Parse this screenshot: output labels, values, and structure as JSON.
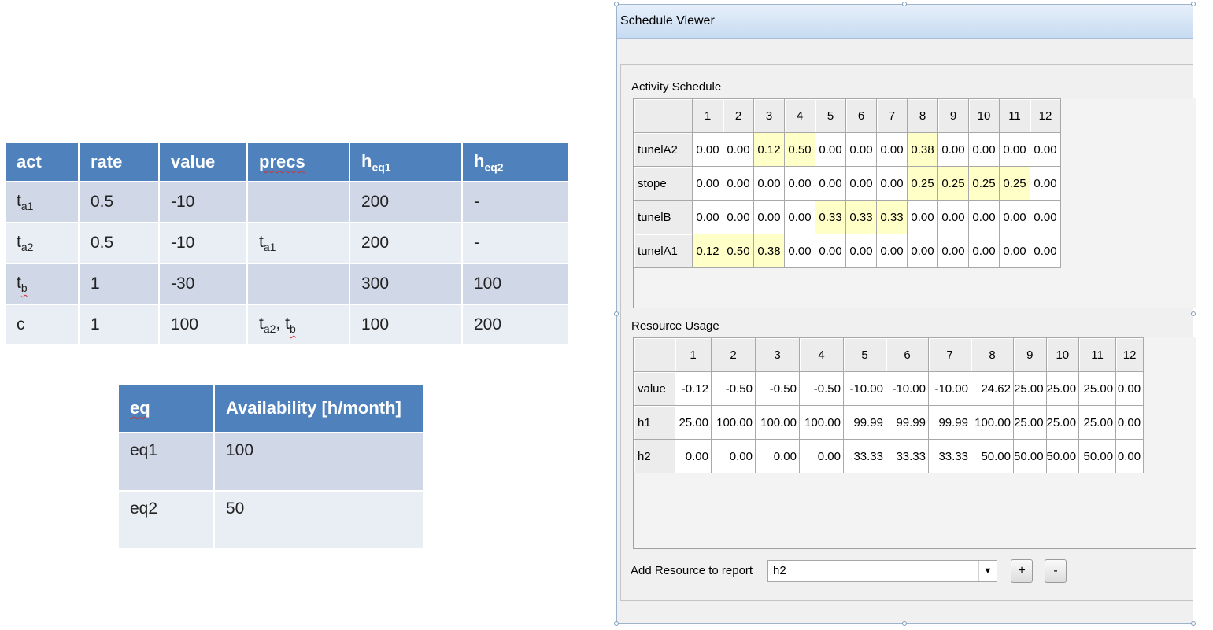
{
  "params_table": {
    "headers": [
      {
        "base": "act",
        "sub": ""
      },
      {
        "base": "rate",
        "sub": ""
      },
      {
        "base": "value",
        "sub": ""
      },
      {
        "base": "precs",
        "sub": ""
      },
      {
        "base": "h",
        "sub": "eq1"
      },
      {
        "base": "h",
        "sub": "eq2"
      }
    ],
    "rows": [
      {
        "act": {
          "base": "t",
          "sub": "a1"
        },
        "rate": "0.5",
        "value": "-10",
        "precs": [],
        "heq1": "200",
        "heq2": "-"
      },
      {
        "act": {
          "base": "t",
          "sub": "a2"
        },
        "rate": "0.5",
        "value": "-10",
        "precs": [
          {
            "base": "t",
            "sub": "a1"
          }
        ],
        "heq1": "200",
        "heq2": "-"
      },
      {
        "act": {
          "base": "t",
          "sub": "b"
        },
        "rate": "1",
        "value": "-30",
        "precs": [],
        "heq1": "300",
        "heq2": "100"
      },
      {
        "act": {
          "base": "c",
          "sub": ""
        },
        "rate": "1",
        "value": "100",
        "precs": [
          {
            "base": "t",
            "sub": "a2"
          },
          {
            "base": "t",
            "sub": "b"
          }
        ],
        "heq1": "100",
        "heq2": "200"
      }
    ]
  },
  "availability_table": {
    "headers": [
      "eq",
      "Availability [h/month]"
    ],
    "rows": [
      [
        "eq1",
        "100"
      ],
      [
        "eq2",
        "50"
      ]
    ]
  },
  "window": {
    "title": "Schedule Viewer",
    "activity_label": "Activity Schedule",
    "activity_columns": [
      "1",
      "2",
      "3",
      "4",
      "5",
      "6",
      "7",
      "8",
      "9",
      "10",
      "11",
      "12"
    ],
    "activity_rows": [
      {
        "name": "tunelA2",
        "values": [
          "0.00",
          "0.00",
          "0.12",
          "0.50",
          "0.00",
          "0.00",
          "0.00",
          "0.38",
          "0.00",
          "0.00",
          "0.00",
          "0.00"
        ],
        "highlight": [
          2,
          3,
          7
        ]
      },
      {
        "name": "stope",
        "values": [
          "0.00",
          "0.00",
          "0.00",
          "0.00",
          "0.00",
          "0.00",
          "0.00",
          "0.25",
          "0.25",
          "0.25",
          "0.25",
          "0.00"
        ],
        "highlight": [
          7,
          8,
          9,
          10
        ]
      },
      {
        "name": "tunelB",
        "values": [
          "0.00",
          "0.00",
          "0.00",
          "0.00",
          "0.33",
          "0.33",
          "0.33",
          "0.00",
          "0.00",
          "0.00",
          "0.00",
          "0.00"
        ],
        "highlight": [
          4,
          5,
          6
        ]
      },
      {
        "name": "tunelA1",
        "values": [
          "0.12",
          "0.50",
          "0.38",
          "0.00",
          "0.00",
          "0.00",
          "0.00",
          "0.00",
          "0.00",
          "0.00",
          "0.00",
          "0.00"
        ],
        "highlight": [
          0,
          1,
          2
        ]
      }
    ],
    "resource_label": "Resource Usage",
    "resource_columns": [
      "1",
      "2",
      "3",
      "4",
      "5",
      "6",
      "7",
      "8",
      "9",
      "10",
      "11",
      "12"
    ],
    "resource_rows": [
      {
        "name": "value",
        "values": [
          "-0.12",
          "-0.50",
          "-0.50",
          "-0.50",
          "-10.00",
          "-10.00",
          "-10.00",
          "24.62",
          "25.00",
          "25.00",
          "25.00",
          "0.00"
        ]
      },
      {
        "name": "h1",
        "values": [
          "25.00",
          "100.00",
          "100.00",
          "100.00",
          "99.99",
          "99.99",
          "99.99",
          "100.00",
          "25.00",
          "25.00",
          "25.00",
          "0.00"
        ]
      },
      {
        "name": "h2",
        "values": [
          "0.00",
          "0.00",
          "0.00",
          "0.00",
          "33.33",
          "33.33",
          "33.33",
          "50.00",
          "50.00",
          "50.00",
          "50.00",
          "0.00"
        ]
      }
    ],
    "add_resource_label": "Add Resource to report",
    "resource_select_value": "h2",
    "plus_label": "+",
    "minus_label": "-"
  },
  "colors": {
    "header_blue": "#4f81bd",
    "row_dark": "#d0d8e8",
    "row_light": "#e9edf4",
    "highlight_yellow": "#ffffc8"
  }
}
